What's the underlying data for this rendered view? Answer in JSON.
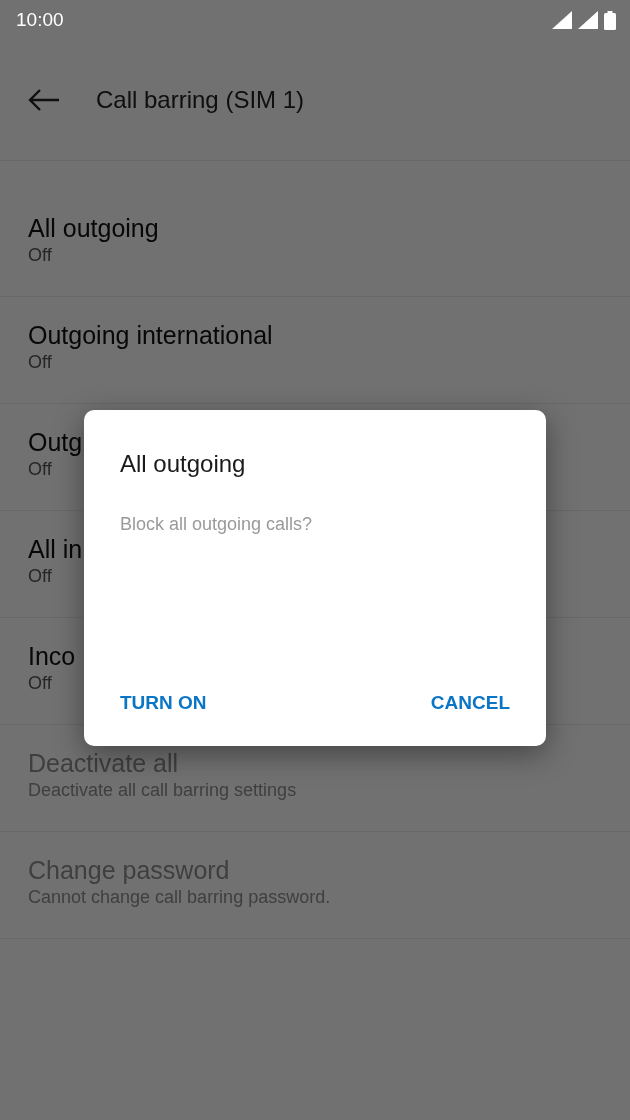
{
  "status_bar": {
    "time": "10:00"
  },
  "toolbar": {
    "title": "Call barring (SIM 1)"
  },
  "items": [
    {
      "title": "All outgoing",
      "summary": "Off",
      "disabled": false
    },
    {
      "title": "Outgoing international",
      "summary": "Off",
      "disabled": false
    },
    {
      "title": "Outg",
      "summary": "Off",
      "disabled": false
    },
    {
      "title": "All in",
      "summary": "Off",
      "disabled": false
    },
    {
      "title": "Inco",
      "summary": "Off",
      "disabled": false
    },
    {
      "title": "Deactivate all",
      "summary": "Deactivate all call barring settings",
      "disabled": true
    },
    {
      "title": "Change password",
      "summary": "Cannot change call barring password.",
      "disabled": true
    }
  ],
  "dialog": {
    "title": "All outgoing",
    "message": "Block all outgoing calls?",
    "buttons": [
      "TURN ON",
      "CANCEL"
    ]
  }
}
